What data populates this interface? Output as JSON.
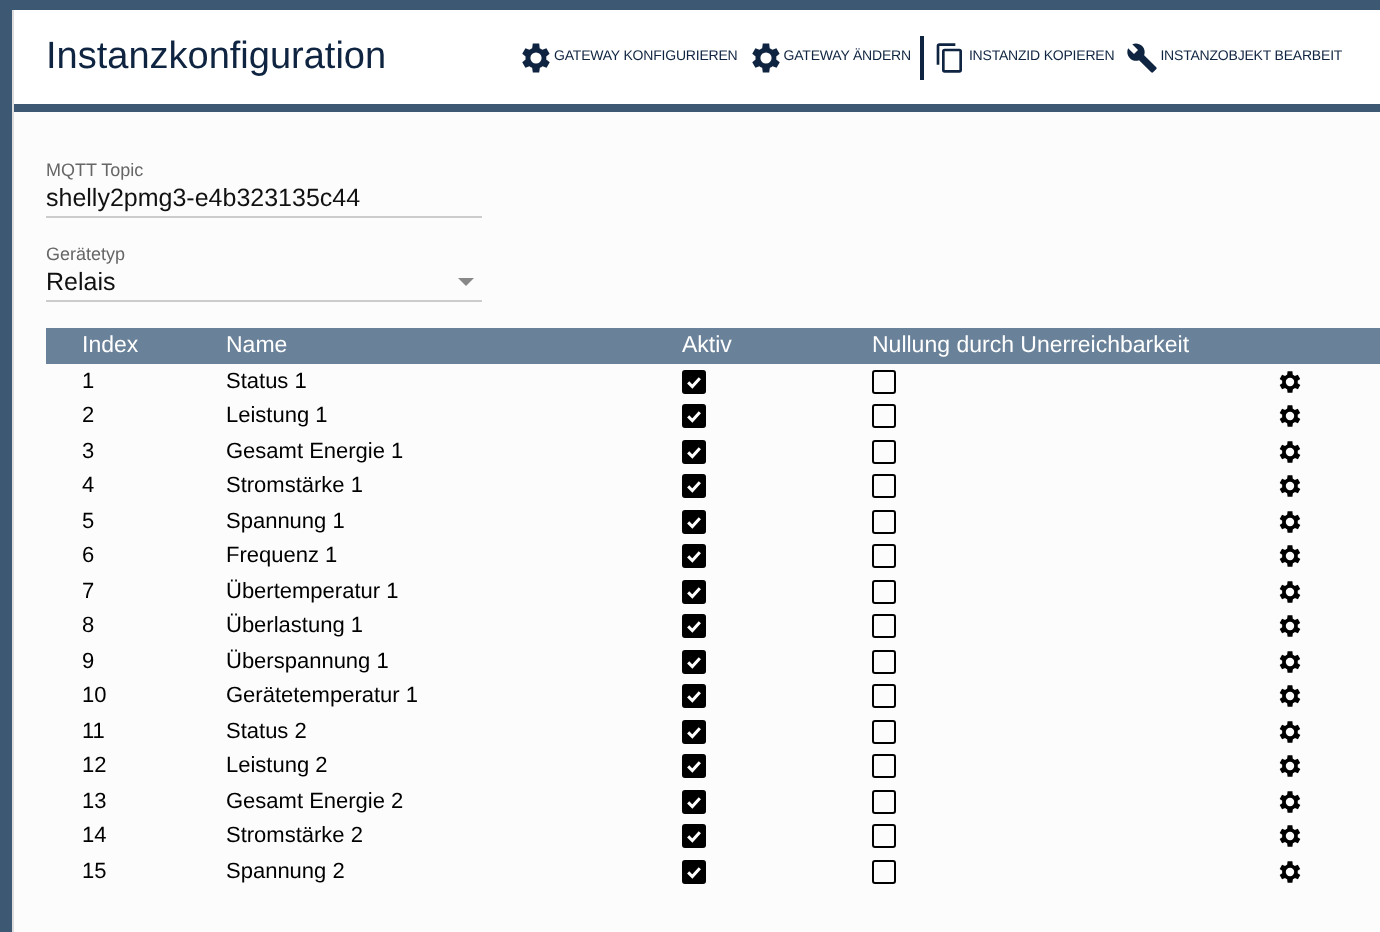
{
  "header": {
    "title": "Instanzkonfiguration",
    "actions": [
      {
        "kind": "gear",
        "label": "GATEWAY KONFIGURIEREN"
      },
      {
        "kind": "gear",
        "label": "GATEWAY ÄNDERN"
      },
      {
        "kind": "divider"
      },
      {
        "kind": "copy",
        "label": "INSTANZID KOPIEREN"
      },
      {
        "kind": "wrench",
        "label": "INSTANZOBJEKT BEARBEIT"
      }
    ]
  },
  "fields": [
    {
      "kind": "text",
      "label": "MQTT Topic",
      "value": "shelly2pmg3-e4b323135c44"
    },
    {
      "kind": "select",
      "label": "Gerätetyp",
      "value": "Relais"
    }
  ],
  "table": {
    "columns": [
      "Index",
      "Name",
      "Aktiv",
      "Nullung durch Unerreichbarkeit"
    ],
    "rows": [
      {
        "index": "1",
        "name": "Status 1",
        "aktiv": true,
        "nullung": false
      },
      {
        "index": "2",
        "name": "Leistung 1",
        "aktiv": true,
        "nullung": false
      },
      {
        "index": "3",
        "name": "Gesamt Energie 1",
        "aktiv": true,
        "nullung": false
      },
      {
        "index": "4",
        "name": "Stromstärke 1",
        "aktiv": true,
        "nullung": false
      },
      {
        "index": "5",
        "name": "Spannung 1",
        "aktiv": true,
        "nullung": false
      },
      {
        "index": "6",
        "name": "Frequenz 1",
        "aktiv": true,
        "nullung": false
      },
      {
        "index": "7",
        "name": "Übertemperatur 1",
        "aktiv": true,
        "nullung": false
      },
      {
        "index": "8",
        "name": "Überlastung 1",
        "aktiv": true,
        "nullung": false
      },
      {
        "index": "9",
        "name": "Überspannung 1",
        "aktiv": true,
        "nullung": false
      },
      {
        "index": "10",
        "name": "Gerätetemperatur 1",
        "aktiv": true,
        "nullung": false
      },
      {
        "index": "11",
        "name": "Status 2",
        "aktiv": true,
        "nullung": false
      },
      {
        "index": "12",
        "name": "Leistung 2",
        "aktiv": true,
        "nullung": false
      },
      {
        "index": "13",
        "name": "Gesamt Energie 2",
        "aktiv": true,
        "nullung": false
      },
      {
        "index": "14",
        "name": "Stromstärke 2",
        "aktiv": true,
        "nullung": false
      },
      {
        "index": "15",
        "name": "Spannung 2",
        "aktiv": true,
        "nullung": false
      }
    ]
  }
}
